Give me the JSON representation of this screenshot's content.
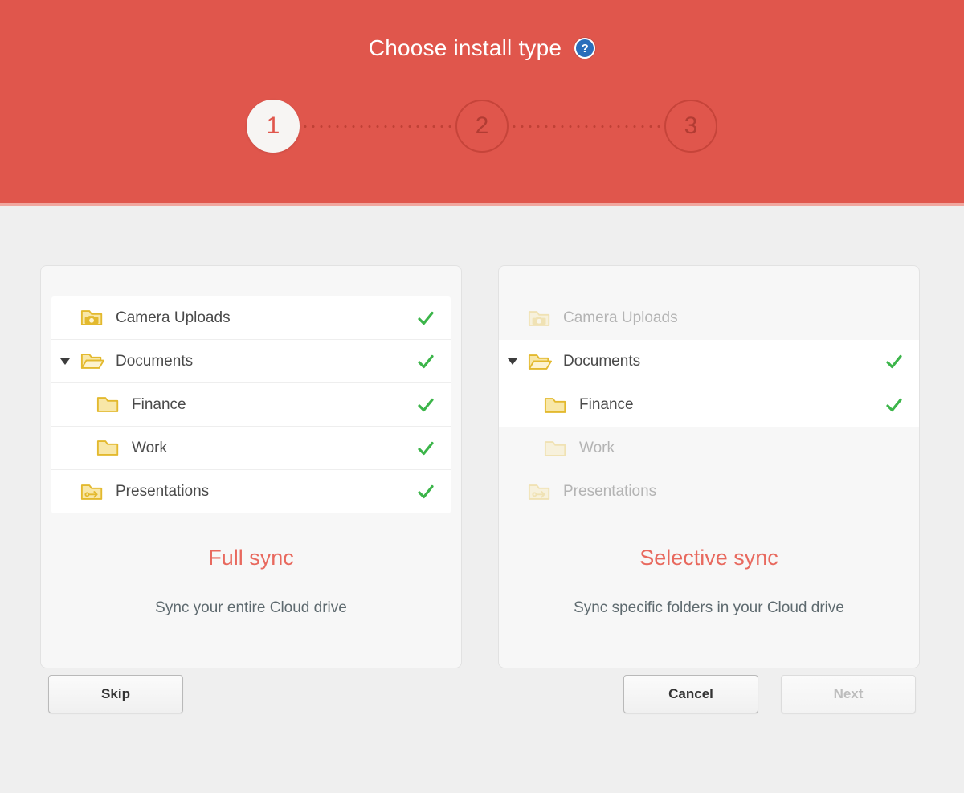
{
  "header": {
    "title": "Choose install type",
    "help_icon": "help-circle-icon",
    "help_glyph": "?",
    "bg_color": "#e0564c",
    "border_color": "#f0a79f"
  },
  "stepper": {
    "steps": [
      {
        "label": "1",
        "state": "active"
      },
      {
        "label": "2",
        "state": "inactive"
      },
      {
        "label": "3",
        "state": "inactive"
      }
    ]
  },
  "cards": [
    {
      "id": "full-sync",
      "title": "Full sync",
      "description": "Sync your entire Cloud drive",
      "title_color": "#e8695e",
      "tree": [
        {
          "name": "Camera Uploads",
          "icon": "camera-folder-icon",
          "depth": 0,
          "expandable": false,
          "checked": true,
          "dimmed": false
        },
        {
          "name": "Documents",
          "icon": "open-folder-icon",
          "depth": 0,
          "expandable": true,
          "checked": true,
          "dimmed": false
        },
        {
          "name": "Finance",
          "icon": "folder-icon",
          "depth": 1,
          "expandable": false,
          "checked": true,
          "dimmed": false
        },
        {
          "name": "Work",
          "icon": "folder-icon",
          "depth": 1,
          "expandable": false,
          "checked": true,
          "dimmed": false
        },
        {
          "name": "Presentations",
          "icon": "shared-folder-icon",
          "depth": 0,
          "expandable": false,
          "checked": true,
          "dimmed": false
        }
      ]
    },
    {
      "id": "selective-sync",
      "title": "Selective sync",
      "description": "Sync specific folders in your Cloud drive",
      "title_color": "#e8695e",
      "tree": [
        {
          "name": "Camera Uploads",
          "icon": "camera-folder-icon",
          "depth": 0,
          "expandable": false,
          "checked": false,
          "dimmed": true
        },
        {
          "name": "Documents",
          "icon": "open-folder-icon",
          "depth": 0,
          "expandable": true,
          "checked": true,
          "dimmed": false
        },
        {
          "name": "Finance",
          "icon": "folder-icon",
          "depth": 1,
          "expandable": false,
          "checked": true,
          "dimmed": false
        },
        {
          "name": "Work",
          "icon": "folder-icon",
          "depth": 1,
          "expandable": false,
          "checked": false,
          "dimmed": true
        },
        {
          "name": "Presentations",
          "icon": "shared-folder-icon",
          "depth": 0,
          "expandable": false,
          "checked": false,
          "dimmed": true
        }
      ]
    }
  ],
  "footer": {
    "skip_label": "Skip",
    "cancel_label": "Cancel",
    "next_label": "Next",
    "next_disabled": true
  },
  "colors": {
    "accent": "#e0564c",
    "check": "#3cb54a",
    "folder": "#f0c94b",
    "page_bg": "#efefef"
  }
}
